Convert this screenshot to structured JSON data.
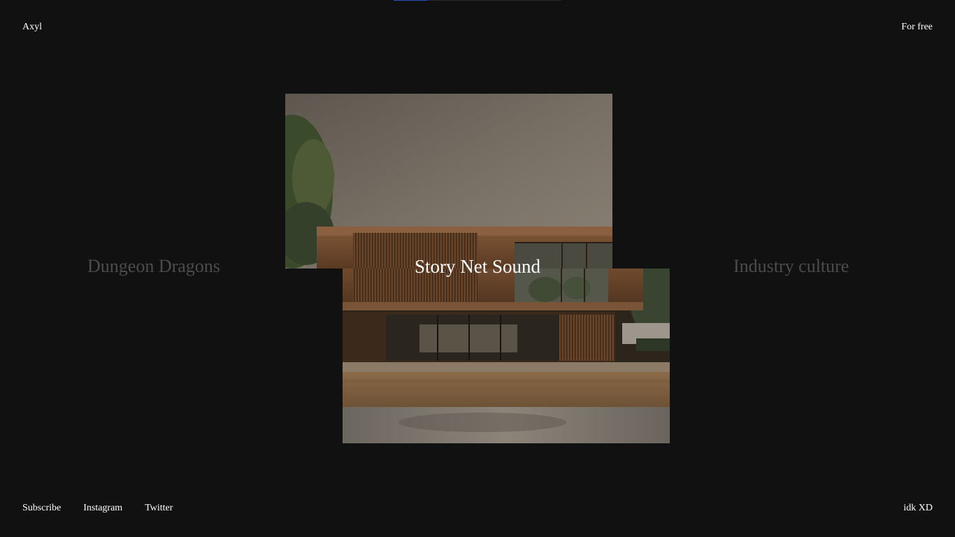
{
  "header": {
    "brand": "Axyl",
    "right_link": "For free"
  },
  "loader": {
    "progress": 0.2,
    "accent_color": "#2b50c8"
  },
  "slider": {
    "left_title": "Dungeon Dragons",
    "center_title": "Story Net Sound",
    "right_title": "Industry culture",
    "image_subject": "modern-house-photo"
  },
  "footer": {
    "links": [
      "Subscribe",
      "Instagram",
      "Twitter"
    ],
    "right_text": "idk XD"
  },
  "colors": {
    "background": "#111111",
    "text": "#ffffff",
    "muted_title": "#4c4c4c"
  }
}
